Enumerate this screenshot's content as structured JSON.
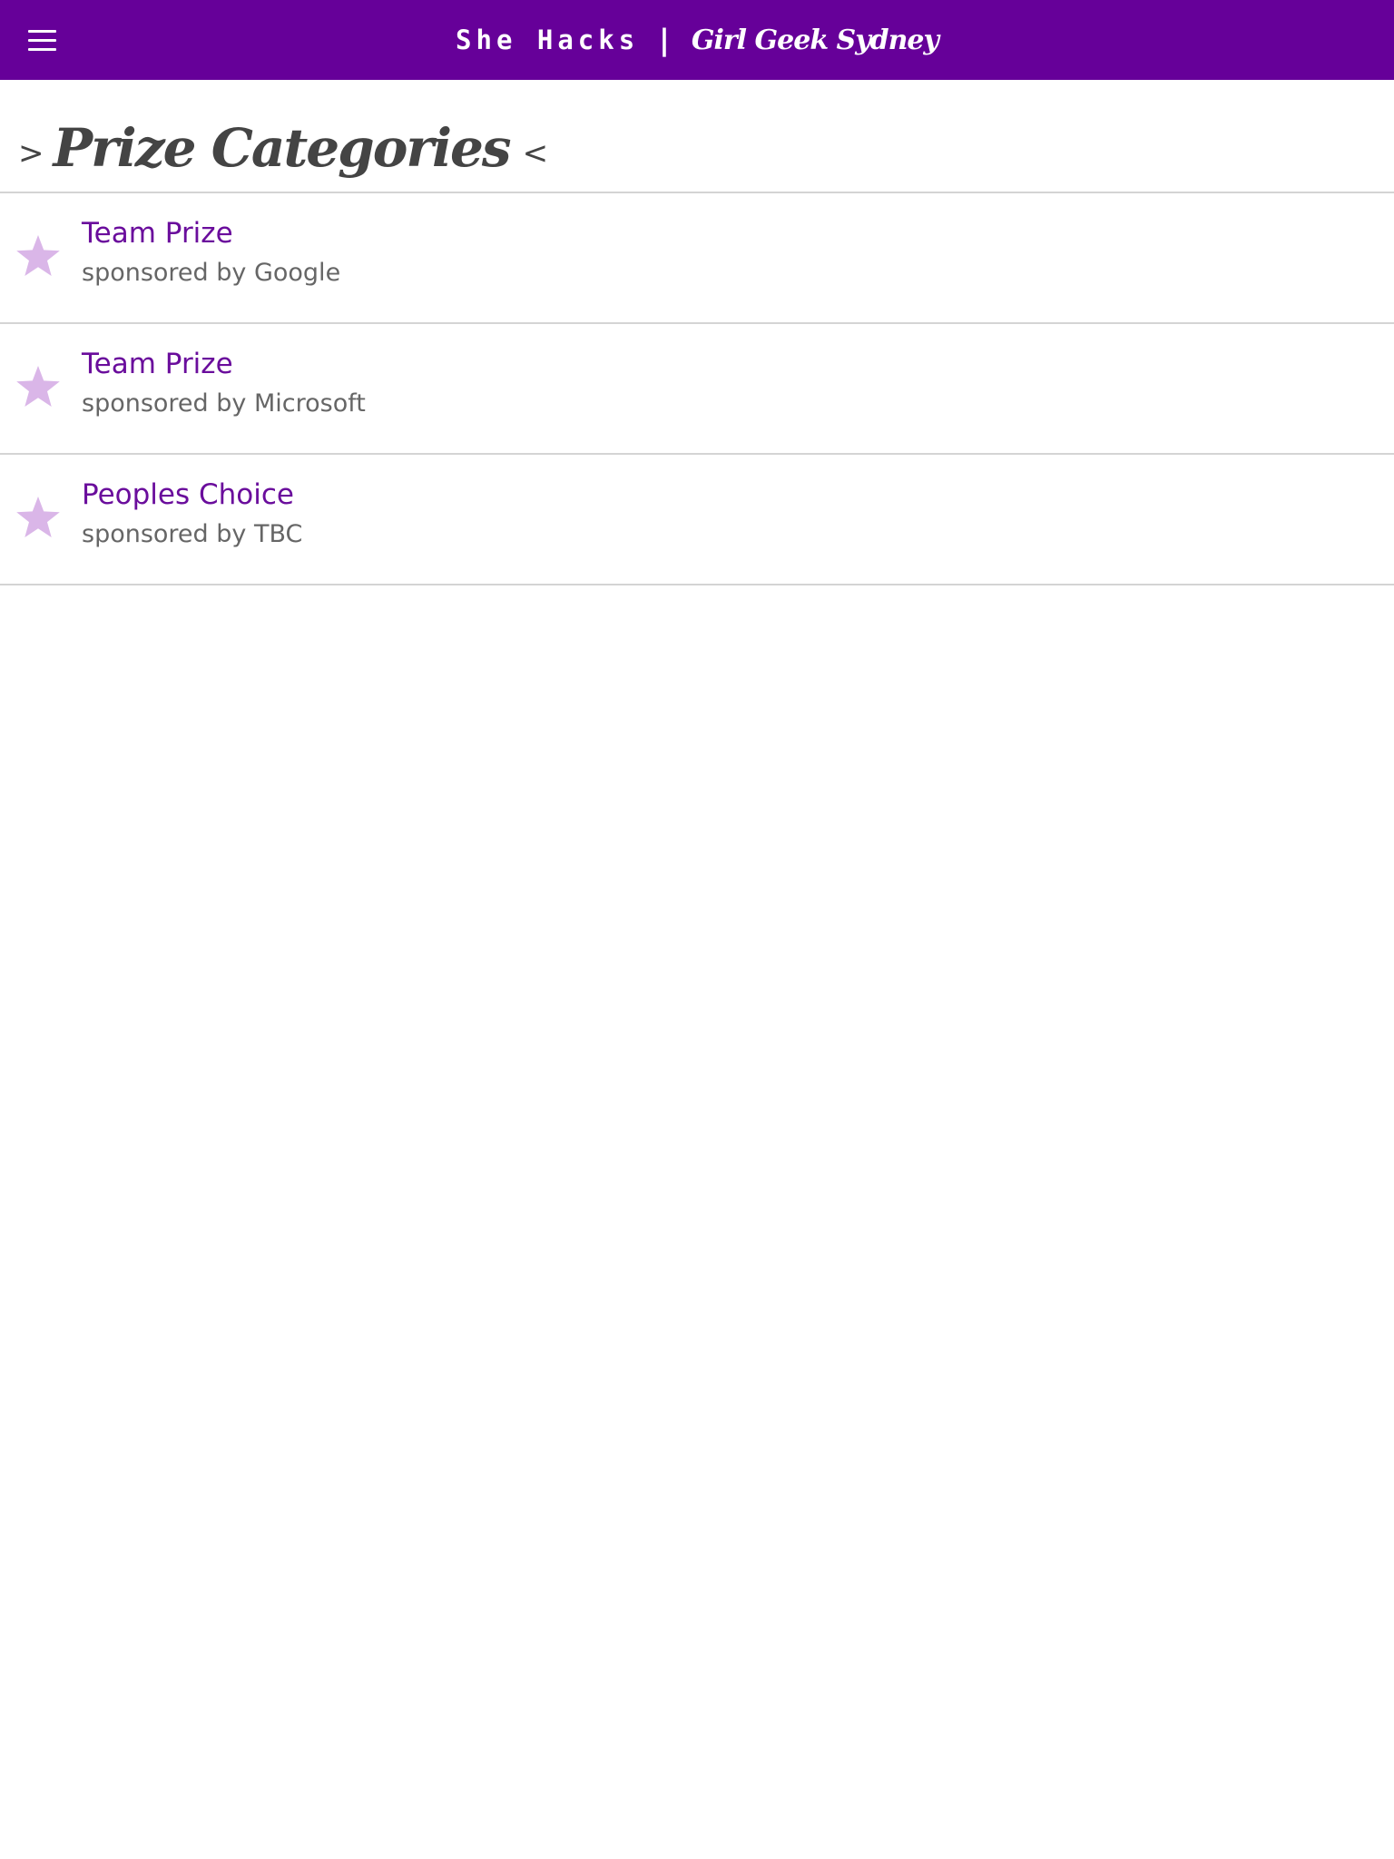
{
  "header": {
    "menu_icon": "hamburger-menu-icon",
    "title_left": "She Hacks",
    "title_separator": "|",
    "title_right": "Girl Geek Sydney",
    "background_color": "#660099"
  },
  "page": {
    "heading_prefix": ">",
    "heading": "Prize Categories",
    "heading_suffix": "<"
  },
  "prizes": [
    {
      "title": "Team Prize",
      "sponsor": "sponsored by Google",
      "icon": "star-icon"
    },
    {
      "title": "Team Prize",
      "sponsor": "sponsored by Microsoft",
      "icon": "star-icon"
    },
    {
      "title": "Peoples Choice",
      "sponsor": "sponsored by TBC",
      "icon": "star-icon"
    }
  ],
  "colors": {
    "accent": "#660099",
    "prize_title": "#6a0d9c",
    "star": "#dab6e8",
    "sponsor_text": "#666666",
    "divider": "#d4d4d4"
  }
}
